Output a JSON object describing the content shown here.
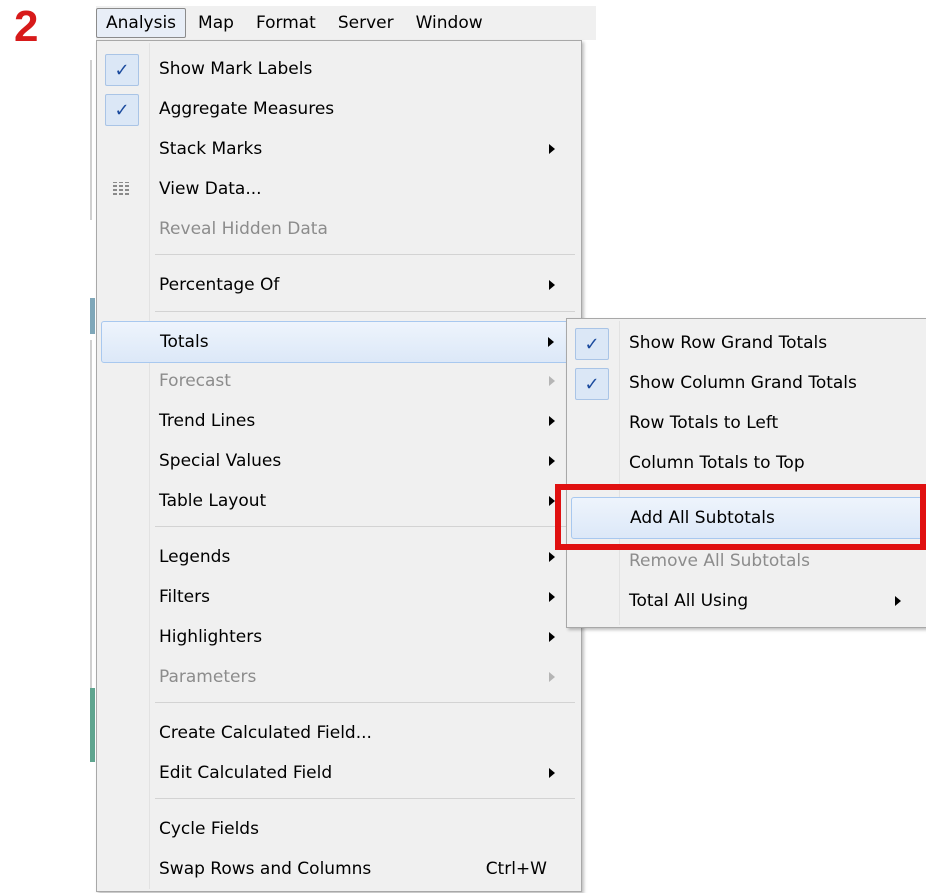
{
  "step_number": "2",
  "menubar": {
    "items": [
      "Analysis",
      "Map",
      "Format",
      "Server",
      "Window"
    ]
  },
  "analysis_menu": {
    "items": [
      {
        "label": "Show Mark Labels",
        "checked": true
      },
      {
        "label": "Aggregate Measures",
        "checked": true
      },
      {
        "label": "Stack Marks",
        "submenu": true
      },
      {
        "label": "View Data...",
        "icon": "grid-icon"
      },
      {
        "label": "Reveal Hidden Data",
        "disabled": true
      },
      {
        "label": "Percentage Of",
        "submenu": true
      },
      {
        "label": "Totals",
        "submenu": true,
        "highlighted": true
      },
      {
        "label": "Forecast",
        "submenu": true,
        "disabled": true
      },
      {
        "label": "Trend Lines",
        "submenu": true
      },
      {
        "label": "Special Values",
        "submenu": true
      },
      {
        "label": "Table Layout",
        "submenu": true
      },
      {
        "label": "Legends",
        "submenu": true
      },
      {
        "label": "Filters",
        "submenu": true
      },
      {
        "label": "Highlighters",
        "submenu": true
      },
      {
        "label": "Parameters",
        "submenu": true,
        "disabled": true
      },
      {
        "label": "Create Calculated Field..."
      },
      {
        "label": "Edit Calculated Field",
        "submenu": true
      },
      {
        "label": "Cycle Fields"
      },
      {
        "label": "Swap Rows and Columns",
        "shortcut": "Ctrl+W"
      }
    ]
  },
  "totals_submenu": {
    "items": [
      {
        "label": "Show Row Grand Totals",
        "checked": true
      },
      {
        "label": "Show Column Grand Totals",
        "checked": true
      },
      {
        "label": "Row Totals to Left"
      },
      {
        "label": "Column Totals to Top"
      },
      {
        "label": "Add All Subtotals",
        "highlighted": true
      },
      {
        "label": "Remove All Subtotals",
        "disabled": true
      },
      {
        "label": "Total All Using",
        "submenu": true
      }
    ]
  },
  "checkmark": "✓",
  "colors": {
    "callout": "#e01010",
    "highlight": "#dce8f8",
    "disabled_text": "#8c8c8c"
  }
}
